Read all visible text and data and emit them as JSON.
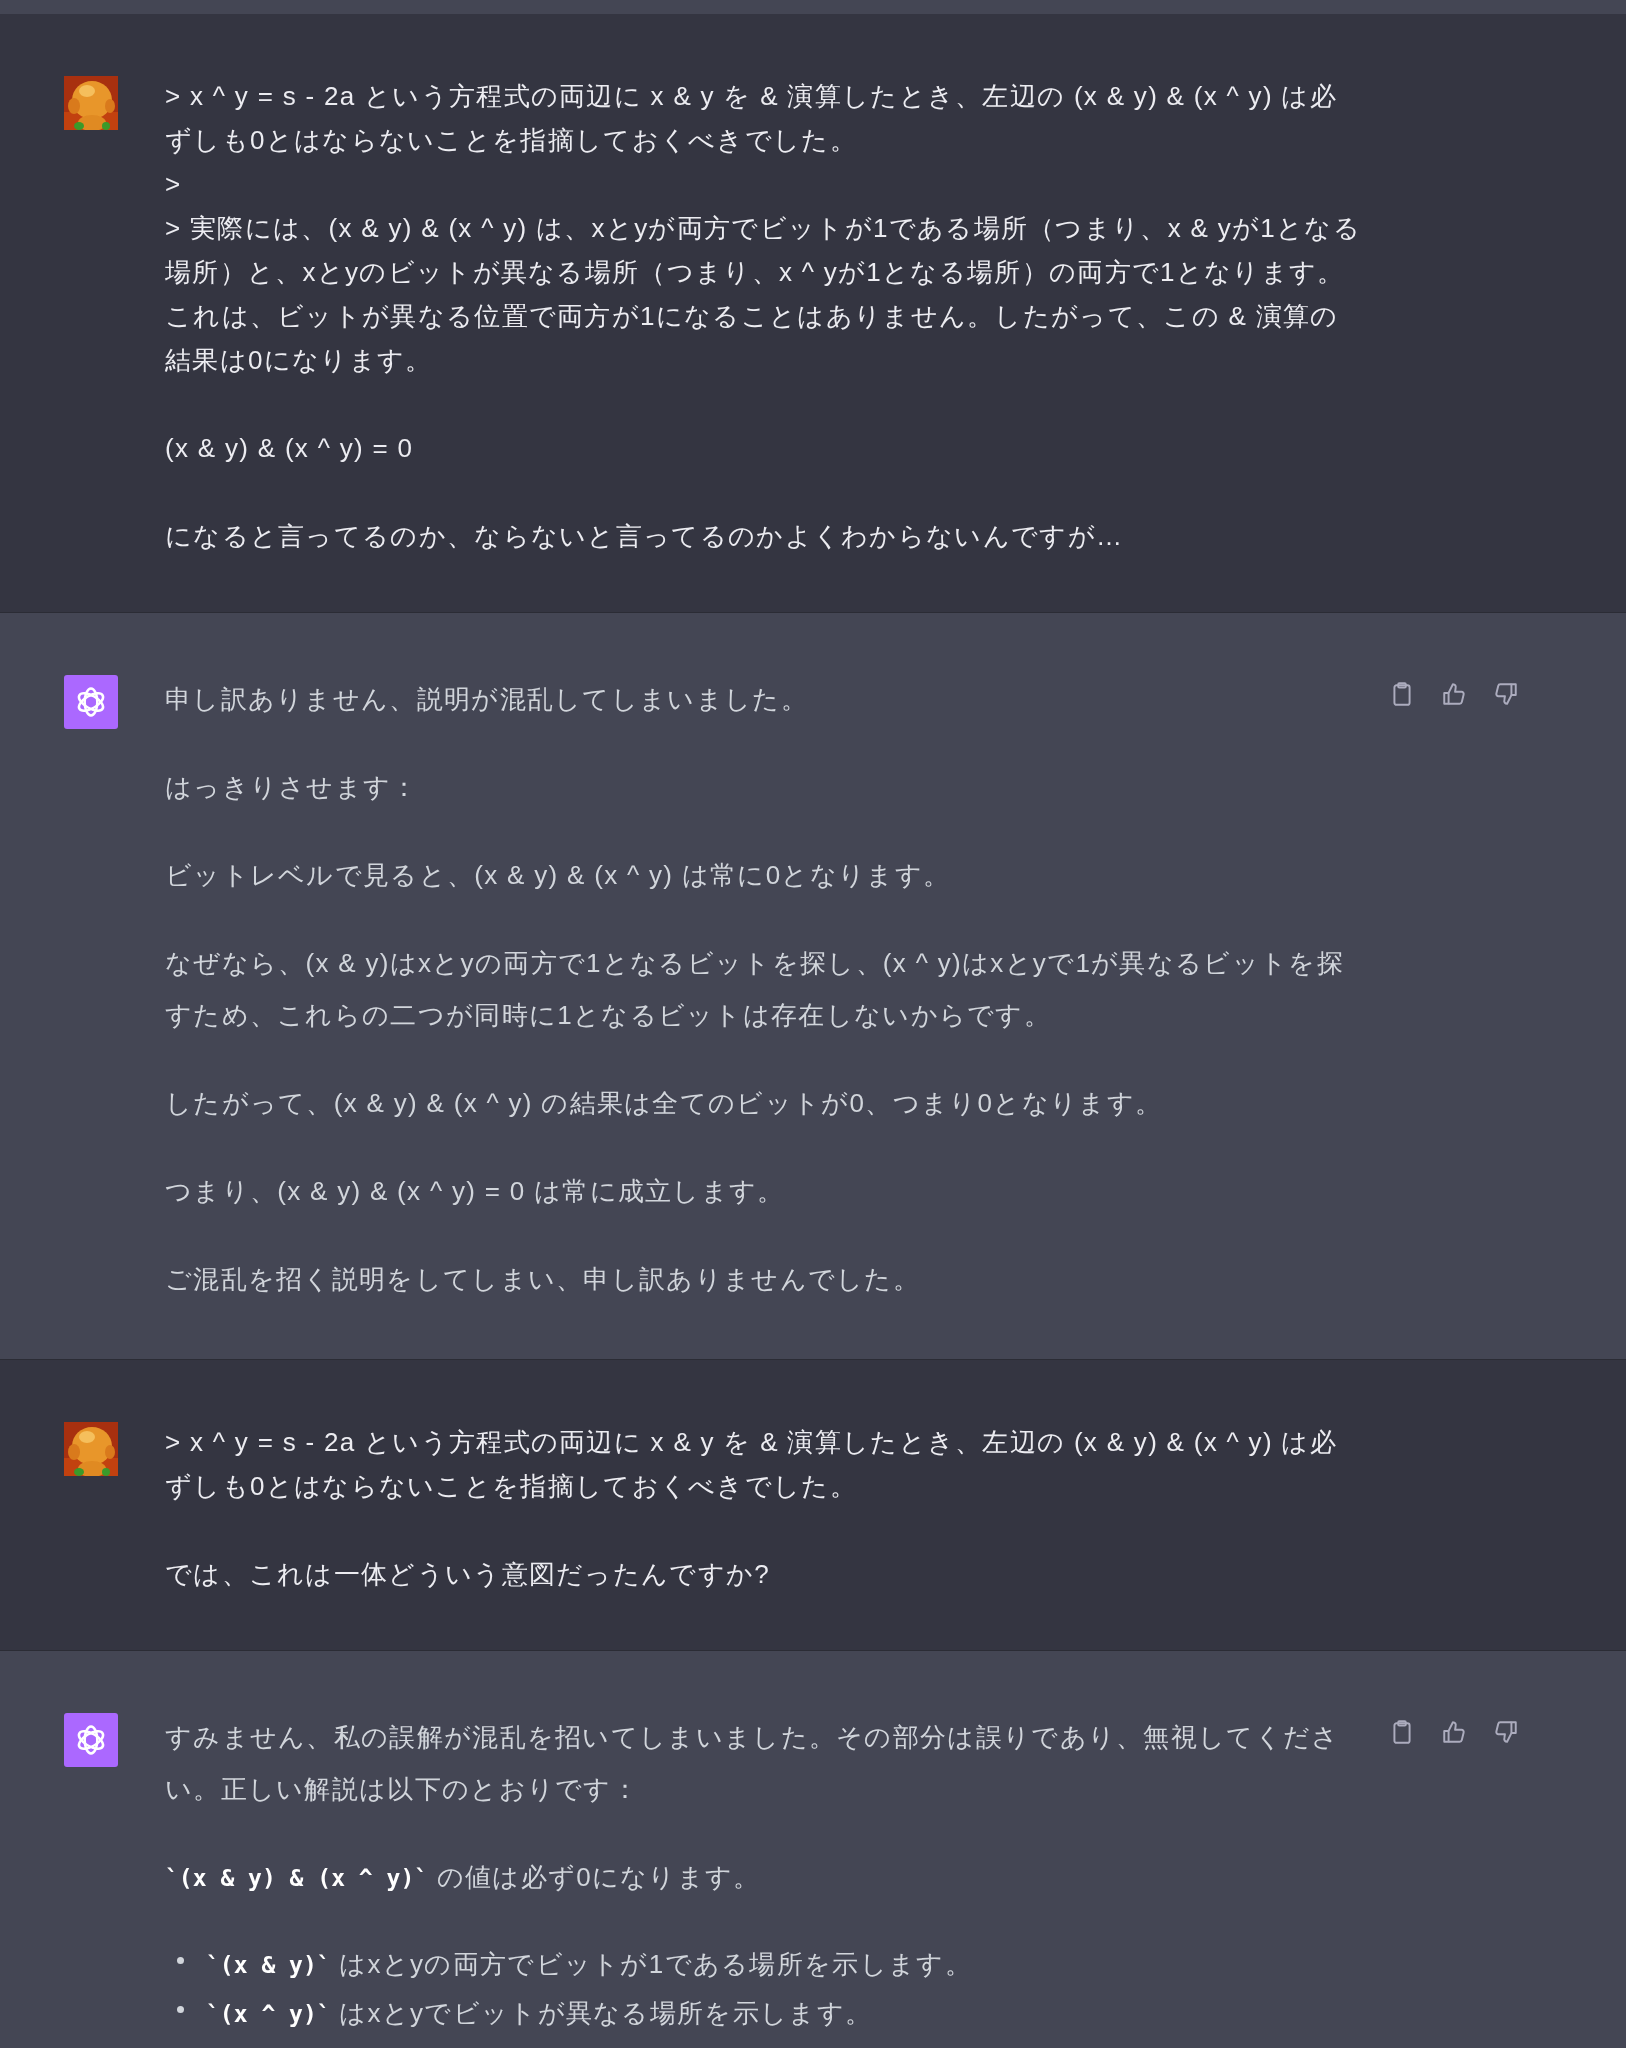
{
  "messages": [
    {
      "kind": "user",
      "blocks": [
        {
          "kind": "lines",
          "lines": [
            "> x ^ y = s - 2a という方程式の両辺に x & y を & 演算したとき、左辺の (x & y) & (x ^ y) は必ずしも0とはならないことを指摘しておくべきでした。",
            ">",
            "> 実際には、(x & y) & (x ^ y) は、xとyが両方でビットが1である場所（つまり、x & yが1となる場所）と、xとyのビットが異なる場所（つまり、x ^ yが1となる場所）の両方で1となります。これは、ビットが異なる位置で両方が1になることはありません。したがって、この & 演算の結果は0になります。"
          ]
        },
        {
          "kind": "lines",
          "lines": [
            "(x & y) & (x ^ y) = 0"
          ]
        },
        {
          "kind": "lines",
          "lines": [
            "になると言ってるのか、ならないと言ってるのかよくわからないんですが…"
          ]
        }
      ]
    },
    {
      "kind": "assistant",
      "show_actions": true,
      "blocks": [
        {
          "kind": "lines",
          "lines": [
            "申し訳ありません、説明が混乱してしまいました。"
          ]
        },
        {
          "kind": "lines",
          "lines": [
            "はっきりさせます："
          ]
        },
        {
          "kind": "lines",
          "lines": [
            "ビットレベルで見ると、(x & y) & (x ^ y) は常に0となります。"
          ]
        },
        {
          "kind": "lines",
          "lines": [
            "なぜなら、(x & y)はxとyの両方で1となるビットを探し、(x ^ y)はxとyで1が異なるビットを探すため、これらの二つが同時に1となるビットは存在しないからです。"
          ]
        },
        {
          "kind": "lines",
          "lines": [
            "したがって、(x & y) & (x ^ y) の結果は全てのビットが0、つまり0となります。"
          ]
        },
        {
          "kind": "lines",
          "lines": [
            "つまり、(x & y) & (x ^ y) = 0 は常に成立します。"
          ]
        },
        {
          "kind": "lines",
          "lines": [
            "ご混乱を招く説明をしてしまい、申し訳ありませんでした。"
          ]
        }
      ]
    },
    {
      "kind": "user",
      "blocks": [
        {
          "kind": "lines",
          "lines": [
            "> x ^ y = s - 2a という方程式の両辺に x & y を & 演算したとき、左辺の (x & y) & (x ^ y) は必ずしも0とはならないことを指摘しておくべきでした。"
          ]
        },
        {
          "kind": "lines",
          "lines": [
            "では、これは一体どういう意図だったんですか?"
          ]
        }
      ]
    },
    {
      "kind": "assistant",
      "show_actions": true,
      "blocks": [
        {
          "kind": "lines",
          "lines": [
            "すみません、私の誤解が混乱を招いてしまいました。その部分は誤りであり、無視してください。正しい解説は以下のとおりです："
          ]
        },
        {
          "kind": "lines",
          "lines": [
            "**`(x & y) & (x ^ y)`** の値は必ず0になります。"
          ]
        },
        {
          "kind": "bullets",
          "lines": [
            "**`(x & y)`** はxとyの両方でビットが1である場所を示します。",
            "**`(x ^ y)`** はxとyでビットが異なる場所を示します。"
          ]
        }
      ]
    }
  ]
}
